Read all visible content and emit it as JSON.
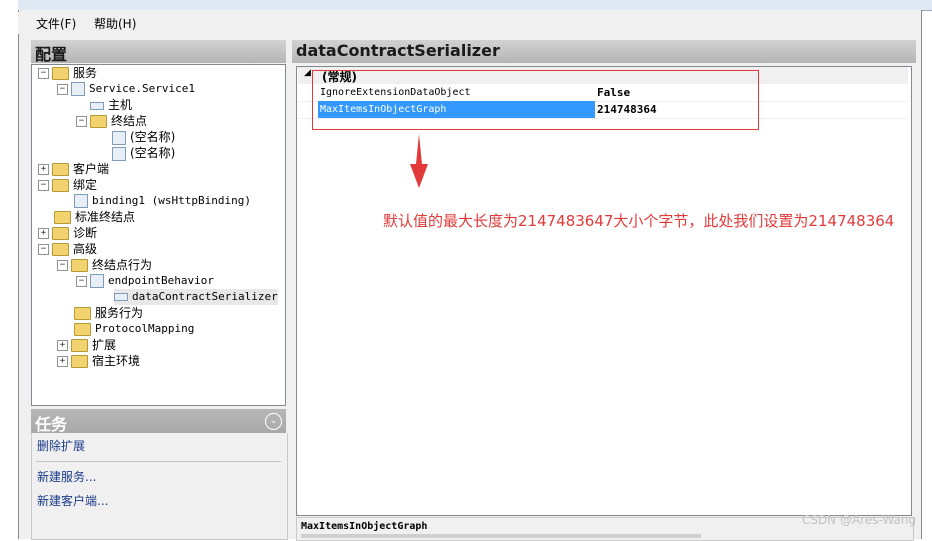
{
  "menu": {
    "file": "文件(F)",
    "help": "帮助(H)"
  },
  "config_header": "配置",
  "tree": {
    "services": "服务",
    "service1": "Service.Service1",
    "host": "主机",
    "endpoints": "终结点",
    "empty1": "(空名称)",
    "empty2": "(空名称)",
    "client": "客户端",
    "bindings": "绑定",
    "binding1": "binding1 (wsHttpBinding)",
    "standard_endpoints": "标准终结点",
    "diagnostics": "诊断",
    "advanced": "高级",
    "endpoint_behaviors": "终结点行为",
    "endpoint_behavior": "endpointBehavior",
    "data_contract_serializer": "dataContractSerializer",
    "service_behaviors": "服务行为",
    "protocol_mapping": "ProtocolMapping",
    "extensions": "扩展",
    "hosting_env": "宿主环境"
  },
  "tasks": {
    "header": "任务",
    "delete_ext": "删除扩展",
    "new_service": "新建服务...",
    "new_client": "新建客户端..."
  },
  "right_header": "dataContractSerializer",
  "grid": {
    "category": "(常规)",
    "rows": [
      {
        "name": "IgnoreExtensionDataObject",
        "value": "False"
      },
      {
        "name": "MaxItemsInObjectGraph",
        "value": "214748364"
      }
    ]
  },
  "annotation": "默认值的最大长度为2147483647大小个字节，此处我们设置为214748364",
  "description_title": "MaxItemsInObjectGraph",
  "watermark": "CSDN @Ares-Wang",
  "colors": {
    "selection": "#3399ff",
    "annotation": "#e23a3a"
  }
}
